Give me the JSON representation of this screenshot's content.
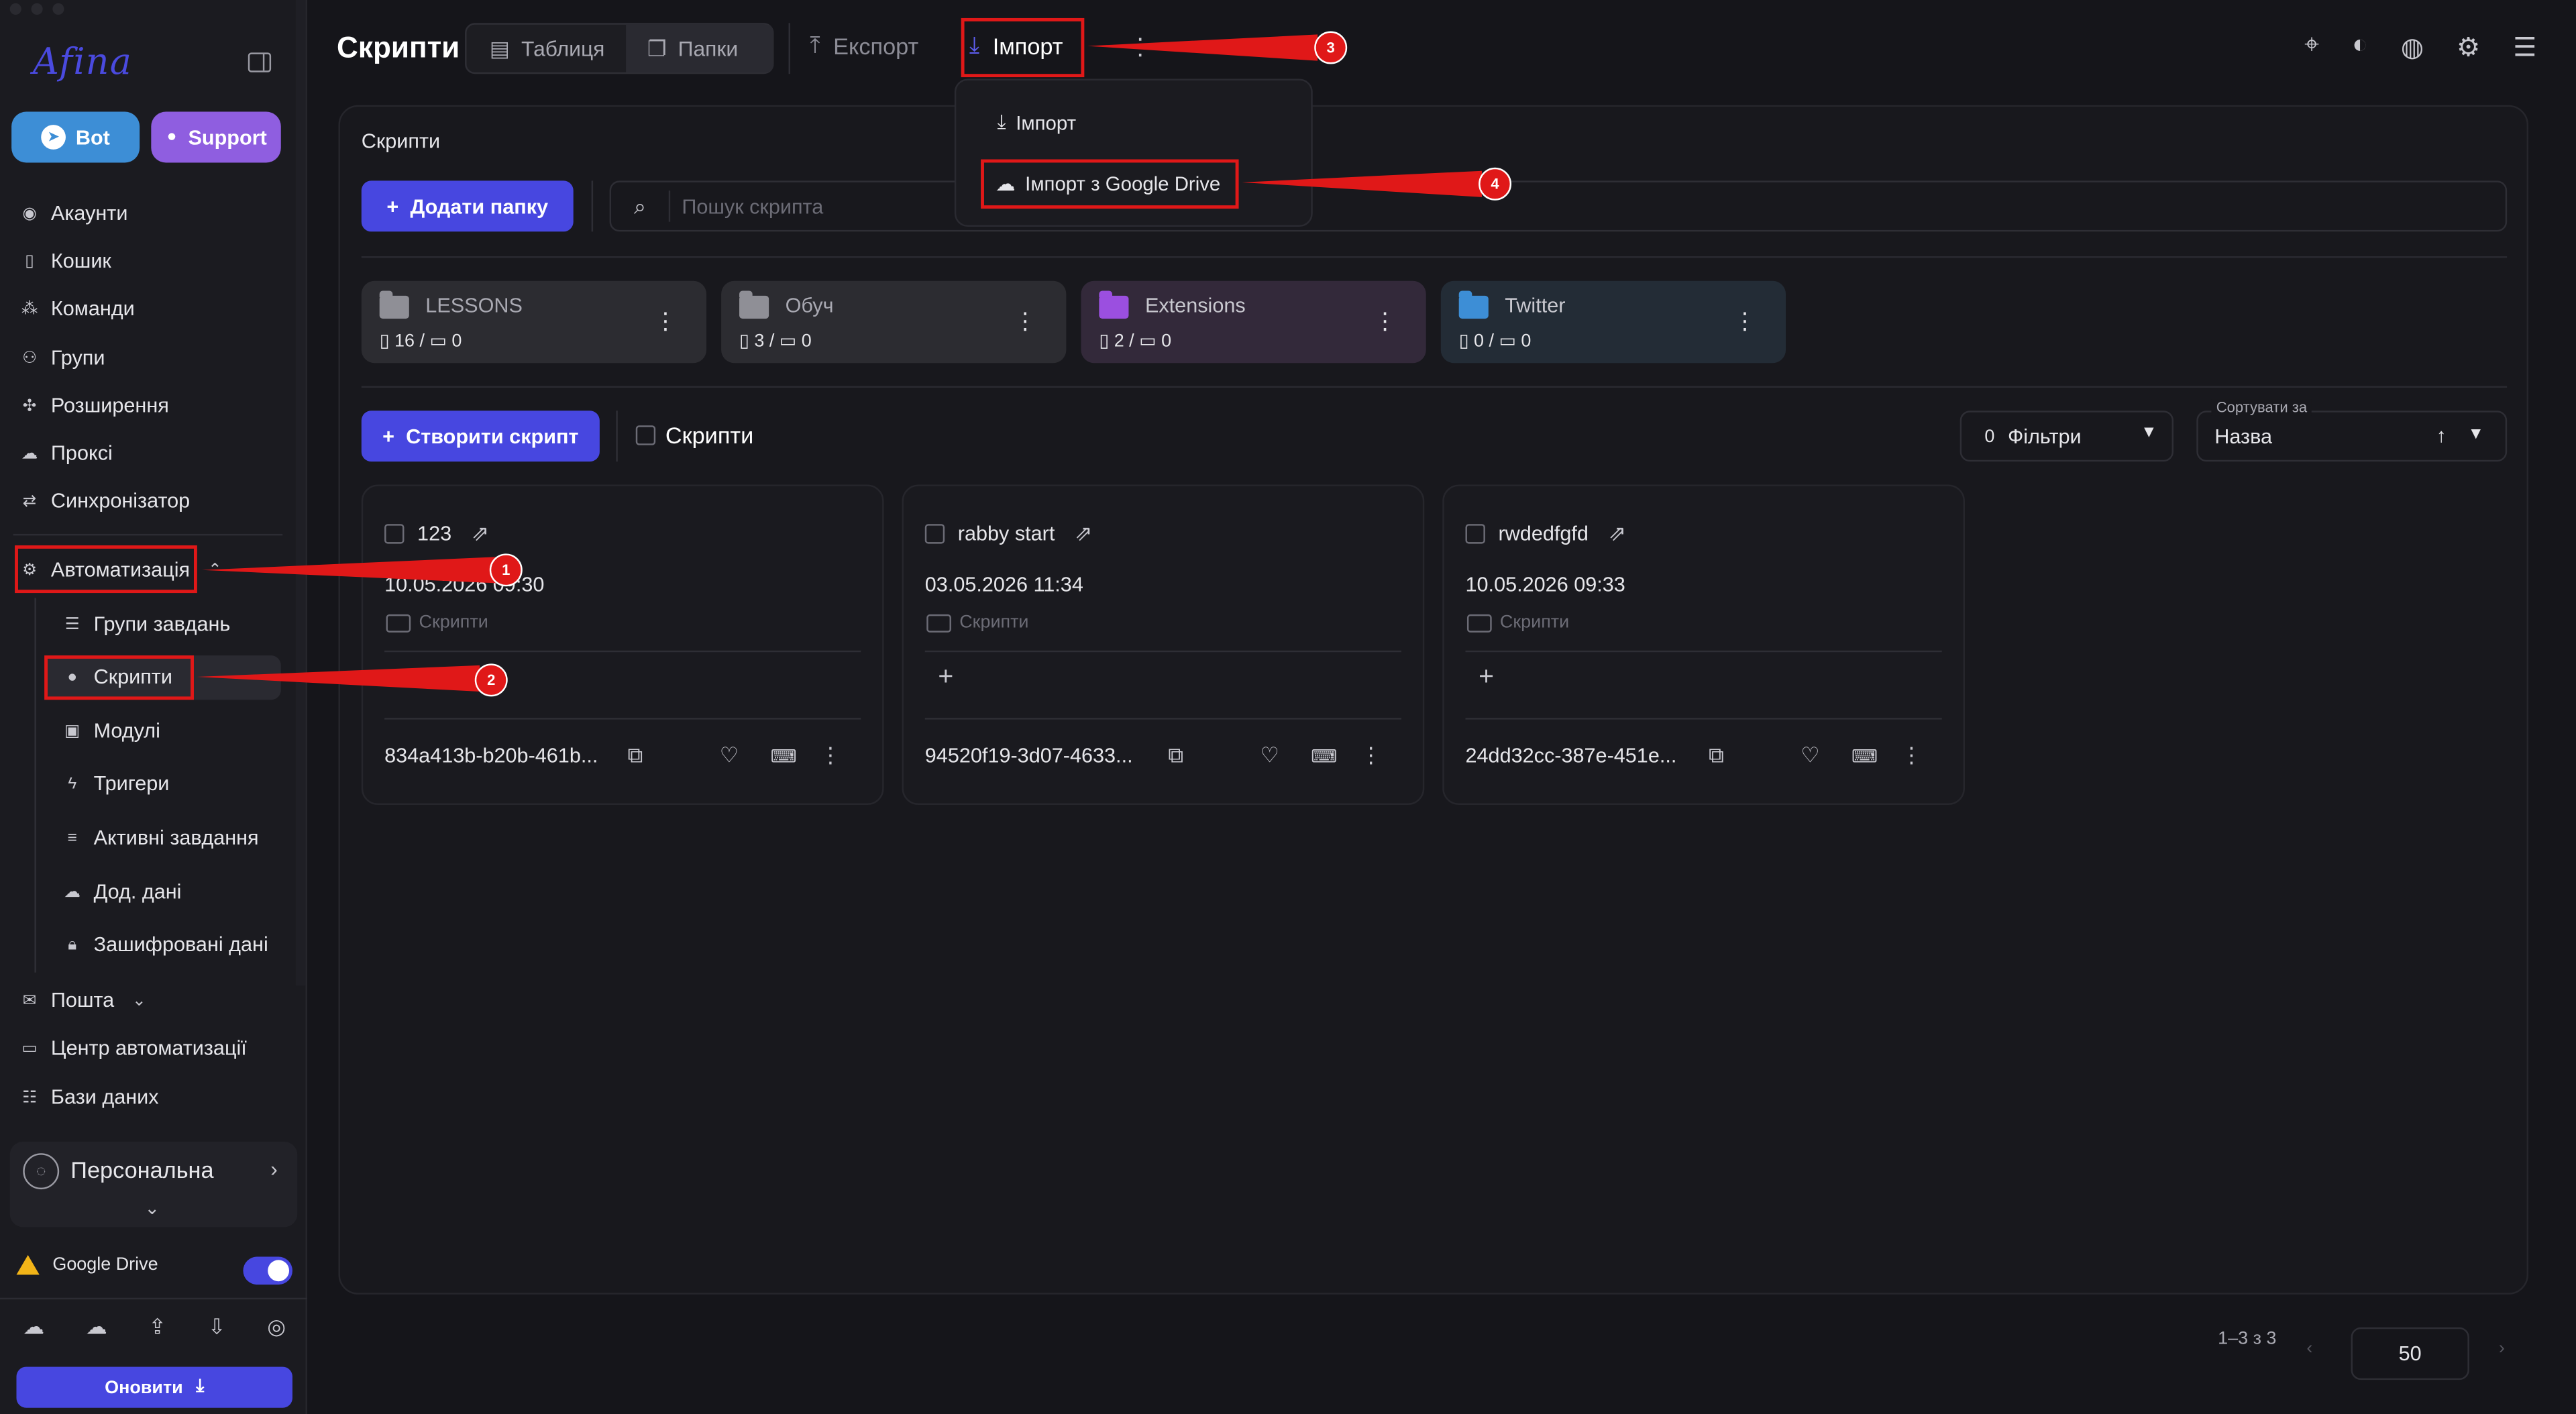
{
  "sidebar": {
    "logo": "Afina",
    "bot_label": "Bot",
    "support_label": "Support",
    "items": [
      {
        "label": "Акаунти",
        "icon": "user-circle-icon"
      },
      {
        "label": "Кошик",
        "icon": "trash-icon"
      },
      {
        "label": "Команди",
        "icon": "team-icon"
      },
      {
        "label": "Групи",
        "icon": "group-icon"
      },
      {
        "label": "Розширення",
        "icon": "puzzle-icon"
      },
      {
        "label": "Проксі",
        "icon": "cloud-icon"
      },
      {
        "label": "Синхронізатор",
        "icon": "sync-icon"
      }
    ],
    "automation": {
      "label": "Автоматизація",
      "icon": "automation-icon",
      "expanded": true
    },
    "sub_items": [
      {
        "label": "Групи завдань",
        "icon": "list-icon"
      },
      {
        "label": "Скрипти",
        "icon": "github-icon",
        "active": true
      },
      {
        "label": "Модулі",
        "icon": "terminal-icon"
      },
      {
        "label": "Тригери",
        "icon": "bolt-icon"
      },
      {
        "label": "Активні завдання",
        "icon": "tasks-icon"
      },
      {
        "label": "Дод. дані",
        "icon": "cloud-upload-icon"
      },
      {
        "label": "Зашифровані дані",
        "icon": "lock-icon"
      }
    ],
    "mail": {
      "label": "Пошта",
      "icon": "mail-icon"
    },
    "automation_center": {
      "label": "Центр автоматизації",
      "icon": "laptop-icon"
    },
    "databases": {
      "label": "Бази даних",
      "icon": "database-icon"
    },
    "profile": {
      "name": "Персональна"
    },
    "google_drive": {
      "label": "Google Drive",
      "enabled": true
    },
    "update_label": "Оновити"
  },
  "topbar": {
    "title": "Скрипти",
    "view_table": "Таблиця",
    "view_folders": "Папки",
    "export_label": "Експорт",
    "import_label": "Імпорт"
  },
  "import_menu": {
    "item1": "Імпорт",
    "item2": "Імпорт з Google Drive"
  },
  "main": {
    "section_label": "Скрипти",
    "add_folder": "Додати папку",
    "search_placeholder": "Пошук скрипта",
    "folders": [
      {
        "name": "LESSONS",
        "files": "16",
        "folders": "0",
        "color": "#8f8f96",
        "bg": "#2c2c31"
      },
      {
        "name": "Обуч",
        "files": "3",
        "folders": "0",
        "color": "#8f8f96",
        "bg": "#2c2c31"
      },
      {
        "name": "Extensions",
        "files": "2",
        "folders": "0",
        "color": "#9b4fe0",
        "bg": "#33293a"
      },
      {
        "name": "Twitter",
        "files": "0",
        "folders": "0",
        "color": "#3d8ed6",
        "bg": "#232c36"
      }
    ],
    "create_script": "Створити скрипт",
    "scripts_checkbox_label": "Скрипти",
    "filters_count": "0",
    "filters_label": "Фільтри",
    "sort_label": "Сортувати за",
    "sort_value": "Назва",
    "scripts": [
      {
        "name": "123",
        "date": "10.05.2026 09:30",
        "folder": "Скрипти",
        "id": "834a413b-b20b-461b..."
      },
      {
        "name": "rabby start",
        "date": "03.05.2026 11:34",
        "folder": "Скрипти",
        "id": "94520f19-3d07-4633..."
      },
      {
        "name": "rwdedfgfd",
        "date": "10.05.2026 09:33",
        "folder": "Скрипти",
        "id": "24dd32cc-387e-451e..."
      }
    ],
    "pagination": {
      "range": "1–3 з 3",
      "per_page": "50"
    }
  },
  "annotations": [
    {
      "number": "1"
    },
    {
      "number": "2"
    },
    {
      "number": "3"
    },
    {
      "number": "4"
    }
  ],
  "colors": {
    "accent": "#4747e0",
    "annotation_red": "#e01818",
    "bot_blue": "#3d8ed6",
    "support_purple": "#8f5ee0"
  }
}
